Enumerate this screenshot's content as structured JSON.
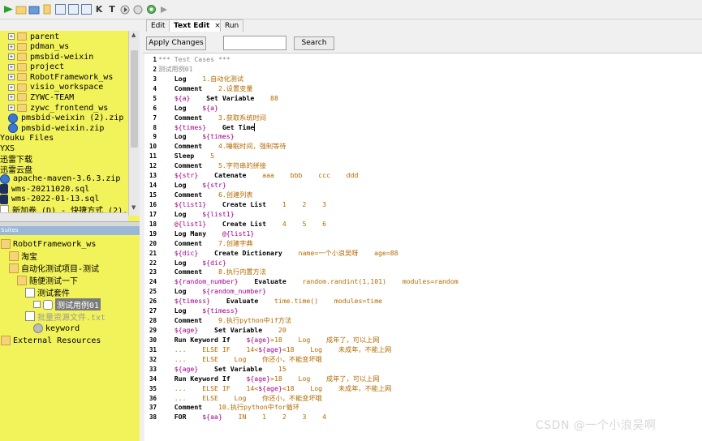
{
  "toolbar": {
    "buttons": [
      "run-icon",
      "folder-open-icon",
      "folder-icon",
      "file-icon",
      "save-icon",
      "save-all-icon",
      "copy-icon",
      "K",
      "T",
      "play-icon",
      "stop-icon",
      "settings-icon",
      "forward-icon"
    ]
  },
  "file_tree": {
    "items": [
      {
        "label": "parent",
        "type": "folder"
      },
      {
        "label": "pdman_ws",
        "type": "folder"
      },
      {
        "label": "pmsbid-weixin",
        "type": "folder"
      },
      {
        "label": "project",
        "type": "folder"
      },
      {
        "label": "RobotFramework_ws",
        "type": "folder"
      },
      {
        "label": "visio_workspace",
        "type": "folder"
      },
      {
        "label": "ZYWC-TEAM",
        "type": "folder"
      },
      {
        "label": "zywc_frontend_ws",
        "type": "folder"
      },
      {
        "label": "pmsbid-weixin (2).zip",
        "type": "zip"
      },
      {
        "label": "pmsbid-weixin.zip",
        "type": "zip"
      },
      {
        "label": "Youku Files",
        "type": "folder"
      },
      {
        "label": "YXS",
        "type": "folder"
      },
      {
        "label": "迅雷下载",
        "type": "folder"
      },
      {
        "label": "迅雷云盘",
        "type": "folder"
      },
      {
        "label": "apache-maven-3.6.3.zip",
        "type": "zip"
      },
      {
        "label": "wms-20211020.sql",
        "type": "sql"
      },
      {
        "label": "wms-2022-01-13.sql",
        "type": "sql"
      },
      {
        "label": "新加卷 (D) - 快捷方式 (2).l",
        "type": "file"
      }
    ]
  },
  "suites": {
    "title": "Suites",
    "items": [
      {
        "label": "RobotFramework_ws",
        "indent": 0,
        "icon": "folder"
      },
      {
        "label": "淘宝",
        "indent": 1,
        "icon": "folder"
      },
      {
        "label": "自动化测试项目-测试",
        "indent": 1,
        "icon": "folder"
      },
      {
        "label": "随便测试一下",
        "indent": 2,
        "icon": "folder"
      },
      {
        "label": "测试套件",
        "indent": 3,
        "icon": "file"
      },
      {
        "label": "测试用例01",
        "indent": 4,
        "icon": "testcase",
        "selected": true
      },
      {
        "label": "批量资源文件.txt",
        "indent": 3,
        "icon": "file",
        "disabled": true
      },
      {
        "label": "keyword",
        "indent": 4,
        "icon": "gear"
      },
      {
        "label": "External Resources",
        "indent": 0,
        "icon": "folder"
      }
    ]
  },
  "tabs": [
    {
      "label": "Edit"
    },
    {
      "label": "Text Edit",
      "active": true,
      "close": "×"
    },
    {
      "label": "Run"
    }
  ],
  "actions": {
    "apply_label": "Apply Changes",
    "search_label": "Search",
    "search_value": ""
  },
  "code_lines": [
    {
      "n": "1",
      "parts": [
        [
          "gy",
          "*** Test Cases ***"
        ]
      ]
    },
    {
      "n": "2",
      "parts": [
        [
          "gy",
          "测试用例01"
        ]
      ]
    },
    {
      "n": "3",
      "parts": [
        [
          "sp",
          "    "
        ],
        [
          "kw",
          "Log"
        ],
        [
          "sp",
          "    "
        ],
        [
          "cm",
          "1.自动化测试"
        ]
      ]
    },
    {
      "n": "4",
      "parts": [
        [
          "sp",
          "    "
        ],
        [
          "kw",
          "Comment"
        ],
        [
          "sp",
          "    "
        ],
        [
          "cm",
          "2.设置变量"
        ]
      ]
    },
    {
      "n": "5",
      "parts": [
        [
          "sp",
          "    "
        ],
        [
          "vr",
          "${a}"
        ],
        [
          "sp",
          "    "
        ],
        [
          "kw",
          "Set Variable"
        ],
        [
          "sp",
          "    "
        ],
        [
          "cm",
          "88"
        ]
      ]
    },
    {
      "n": "6",
      "parts": [
        [
          "sp",
          "    "
        ],
        [
          "kw",
          "Log"
        ],
        [
          "sp",
          "    "
        ],
        [
          "vr",
          "${a}"
        ]
      ]
    },
    {
      "n": "7",
      "parts": [
        [
          "sp",
          "    "
        ],
        [
          "kw",
          "Comment"
        ],
        [
          "sp",
          "    "
        ],
        [
          "cm",
          "3.获取系统时间"
        ]
      ]
    },
    {
      "n": "8",
      "parts": [
        [
          "sp",
          "    "
        ],
        [
          "vr",
          "${times}"
        ],
        [
          "sp",
          "    "
        ],
        [
          "kw",
          "Get Time"
        ]
      ],
      "cursor": true
    },
    {
      "n": "9",
      "parts": [
        [
          "sp",
          "    "
        ],
        [
          "kw",
          "Log"
        ],
        [
          "sp",
          "    "
        ],
        [
          "vr",
          "${times}"
        ]
      ]
    },
    {
      "n": "10",
      "parts": [
        [
          "sp",
          "    "
        ],
        [
          "kw",
          "Comment"
        ],
        [
          "sp",
          "    "
        ],
        [
          "cm",
          "4.睡眠时间，强制等待"
        ]
      ]
    },
    {
      "n": "11",
      "parts": [
        [
          "sp",
          "    "
        ],
        [
          "kw",
          "Sleep"
        ],
        [
          "sp",
          "    "
        ],
        [
          "cm",
          "5"
        ]
      ]
    },
    {
      "n": "12",
      "parts": [
        [
          "sp",
          "    "
        ],
        [
          "kw",
          "Comment"
        ],
        [
          "sp",
          "    "
        ],
        [
          "cm",
          "5.字符串的拼接"
        ]
      ]
    },
    {
      "n": "13",
      "parts": [
        [
          "sp",
          "    "
        ],
        [
          "vr",
          "${str}"
        ],
        [
          "sp",
          "    "
        ],
        [
          "kw",
          "Catenate"
        ],
        [
          "sp",
          "    "
        ],
        [
          "cm",
          "aaa    bbb    ccc    ddd"
        ]
      ]
    },
    {
      "n": "14",
      "parts": [
        [
          "sp",
          "    "
        ],
        [
          "kw",
          "Log"
        ],
        [
          "sp",
          "    "
        ],
        [
          "vr",
          "${str}"
        ]
      ]
    },
    {
      "n": "15",
      "parts": [
        [
          "sp",
          "    "
        ],
        [
          "kw",
          "Comment"
        ],
        [
          "sp",
          "    "
        ],
        [
          "cm",
          "6.创建列表"
        ]
      ]
    },
    {
      "n": "16",
      "parts": [
        [
          "sp",
          "    "
        ],
        [
          "vr",
          "${list1}"
        ],
        [
          "sp",
          "    "
        ],
        [
          "kw",
          "Create List"
        ],
        [
          "sp",
          "    "
        ],
        [
          "cm",
          "1    2    3"
        ]
      ]
    },
    {
      "n": "17",
      "parts": [
        [
          "sp",
          "    "
        ],
        [
          "kw",
          "Log"
        ],
        [
          "sp",
          "    "
        ],
        [
          "vr",
          "${list1}"
        ]
      ]
    },
    {
      "n": "18",
      "parts": [
        [
          "sp",
          "    "
        ],
        [
          "vr",
          "@{list1}"
        ],
        [
          "sp",
          "    "
        ],
        [
          "kw",
          "Create List"
        ],
        [
          "sp",
          "    "
        ],
        [
          "cm",
          "4    5    6"
        ]
      ]
    },
    {
      "n": "19",
      "parts": [
        [
          "sp",
          "    "
        ],
        [
          "kw",
          "Log Many"
        ],
        [
          "sp",
          "    "
        ],
        [
          "vr",
          "@{list1}"
        ]
      ]
    },
    {
      "n": "20",
      "parts": [
        [
          "sp",
          "    "
        ],
        [
          "kw",
          "Comment"
        ],
        [
          "sp",
          "    "
        ],
        [
          "cm",
          "7.创建字典"
        ]
      ]
    },
    {
      "n": "21",
      "parts": [
        [
          "sp",
          "    "
        ],
        [
          "vr",
          "${dic}"
        ],
        [
          "sp",
          "    "
        ],
        [
          "kw",
          "Create Dictionary"
        ],
        [
          "sp",
          "    "
        ],
        [
          "cm",
          "name=一个小浪吴呀    age=88"
        ]
      ]
    },
    {
      "n": "22",
      "parts": [
        [
          "sp",
          "    "
        ],
        [
          "kw",
          "Log"
        ],
        [
          "sp",
          "    "
        ],
        [
          "vr",
          "${dic}"
        ]
      ]
    },
    {
      "n": "23",
      "parts": [
        [
          "sp",
          "    "
        ],
        [
          "kw",
          "Comment"
        ],
        [
          "sp",
          "    "
        ],
        [
          "cm",
          "8.执行内置方法"
        ]
      ]
    },
    {
      "n": "24",
      "parts": [
        [
          "sp",
          "    "
        ],
        [
          "vr",
          "${random_number}"
        ],
        [
          "sp",
          "    "
        ],
        [
          "kw",
          "Evaluate"
        ],
        [
          "sp",
          "    "
        ],
        [
          "cm",
          "random.randint(1,101)    modules=random"
        ]
      ]
    },
    {
      "n": "25",
      "parts": [
        [
          "sp",
          "    "
        ],
        [
          "kw",
          "Log"
        ],
        [
          "sp",
          "    "
        ],
        [
          "vr",
          "${random_number}"
        ]
      ]
    },
    {
      "n": "26",
      "parts": [
        [
          "sp",
          "    "
        ],
        [
          "vr",
          "${timess}"
        ],
        [
          "sp",
          "    "
        ],
        [
          "kw",
          "Evaluate"
        ],
        [
          "sp",
          "    "
        ],
        [
          "cm",
          "time.time()    modules=time"
        ]
      ]
    },
    {
      "n": "27",
      "parts": [
        [
          "sp",
          "    "
        ],
        [
          "kw",
          "Log"
        ],
        [
          "sp",
          "    "
        ],
        [
          "vr",
          "${timess}"
        ]
      ]
    },
    {
      "n": "28",
      "parts": [
        [
          "sp",
          "    "
        ],
        [
          "kw",
          "Comment"
        ],
        [
          "sp",
          "    "
        ],
        [
          "cm",
          "9.执行python中if方法"
        ]
      ]
    },
    {
      "n": "29",
      "parts": [
        [
          "sp",
          "    "
        ],
        [
          "vr",
          "${age}"
        ],
        [
          "sp",
          "    "
        ],
        [
          "kw",
          "Set Variable"
        ],
        [
          "sp",
          "    "
        ],
        [
          "cm",
          "20"
        ]
      ]
    },
    {
      "n": "30",
      "parts": [
        [
          "sp",
          "    "
        ],
        [
          "kw",
          "Run Keyword If"
        ],
        [
          "sp",
          "    "
        ],
        [
          "vr",
          "${age}"
        ],
        [
          "cm",
          ">18    Log    成年了，可以上网"
        ]
      ]
    },
    {
      "n": "31",
      "parts": [
        [
          "sp",
          "    "
        ],
        [
          "cm",
          "...    ELSE IF    14<"
        ],
        [
          "vr",
          "${age}"
        ],
        [
          "cm",
          "<18    Log    未成年，不能上网"
        ]
      ]
    },
    {
      "n": "32",
      "parts": [
        [
          "sp",
          "    "
        ],
        [
          "cm",
          "...    ELSE    Log    你还小，不能变坏哦"
        ]
      ]
    },
    {
      "n": "33",
      "parts": [
        [
          "sp",
          "    "
        ],
        [
          "vr",
          "${age}"
        ],
        [
          "sp",
          "    "
        ],
        [
          "kw",
          "Set Variable"
        ],
        [
          "sp",
          "    "
        ],
        [
          "cm",
          "15"
        ]
      ]
    },
    {
      "n": "34",
      "parts": [
        [
          "sp",
          "    "
        ],
        [
          "kw",
          "Run Keyword If"
        ],
        [
          "sp",
          "    "
        ],
        [
          "vr",
          "${age}"
        ],
        [
          "cm",
          ">18    Log    成年了，可以上网"
        ]
      ]
    },
    {
      "n": "35",
      "parts": [
        [
          "sp",
          "    "
        ],
        [
          "cm",
          "...    ELSE IF    14<"
        ],
        [
          "vr",
          "${age}"
        ],
        [
          "cm",
          "<18    Log    未成年，不能上网"
        ]
      ]
    },
    {
      "n": "36",
      "parts": [
        [
          "sp",
          "    "
        ],
        [
          "cm",
          "...    ELSE    Log    你还小，不能变坏哦"
        ]
      ]
    },
    {
      "n": "37",
      "parts": [
        [
          "sp",
          "    "
        ],
        [
          "kw",
          "Comment"
        ],
        [
          "sp",
          "    "
        ],
        [
          "cm",
          "10.执行python中for循环"
        ]
      ]
    },
    {
      "n": "38",
      "parts": [
        [
          "sp",
          "    "
        ],
        [
          "kw",
          "FOR"
        ],
        [
          "sp",
          "    "
        ],
        [
          "vr",
          "${aa}"
        ],
        [
          "sp",
          "    "
        ],
        [
          "cm",
          "IN    1    2    3    4"
        ]
      ]
    }
  ],
  "watermark": "CSDN @一个小浪吴啊",
  "colors": {
    "panel": "#f2f25a",
    "keyword": "#000000",
    "comment": "#b36b00",
    "variable": "#a1008c"
  }
}
